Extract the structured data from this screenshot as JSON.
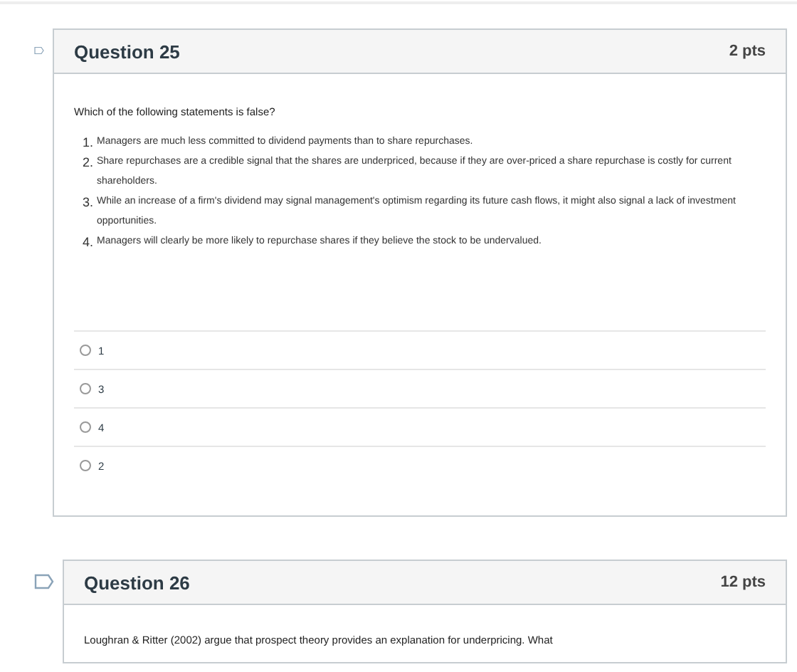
{
  "questions": [
    {
      "title": "Question 25",
      "points": "2 pts",
      "prompt": "Which of the following statements is false?",
      "statements": [
        {
          "number": "1.",
          "text": "Managers are much less committed to dividend payments than to share repurchases."
        },
        {
          "number": "2.",
          "text": "Share repurchases are a credible signal that the shares are underpriced, because if they are over-priced a share repurchase is costly for current shareholders."
        },
        {
          "number": "3.",
          "text": "While an increase of a firm's dividend may signal management's optimism regarding its future cash flows, it might also signal a lack of investment opportunities."
        },
        {
          "number": "4.",
          "text": "Managers will clearly be more likely to repurchase shares if they believe the stock to be undervalued."
        }
      ],
      "answers": [
        {
          "label": "1",
          "selected": false
        },
        {
          "label": "3",
          "selected": false
        },
        {
          "label": "4",
          "selected": false
        },
        {
          "label": "2",
          "selected": false
        }
      ]
    },
    {
      "title": "Question 26",
      "points": "12 pts",
      "prompt": "Loughran & Ritter (2002) argue that prospect theory provides an explanation for underpricing. What"
    }
  ]
}
